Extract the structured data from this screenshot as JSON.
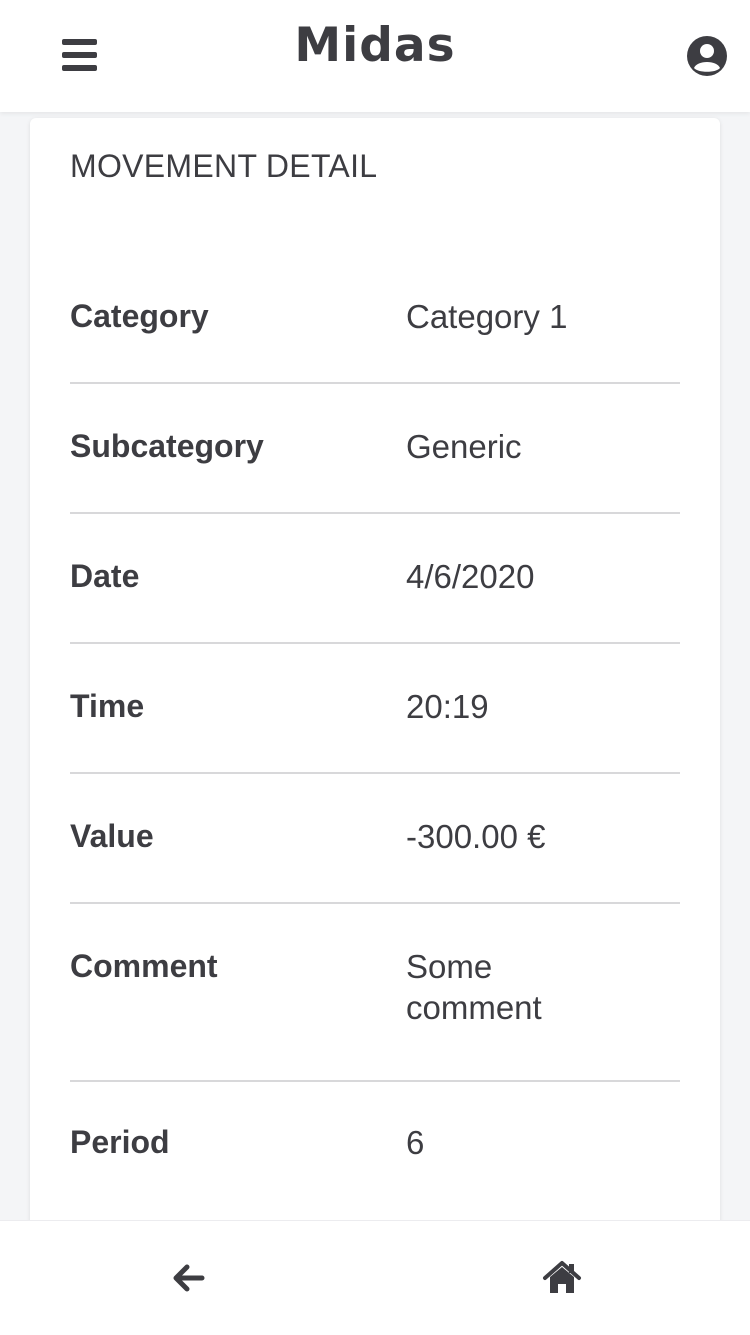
{
  "header": {
    "app_title": "Midas",
    "menu_icon": "hamburger-menu-icon",
    "user_icon": "user-circle-icon"
  },
  "card": {
    "title": "MOVEMENT DETAIL",
    "rows": [
      {
        "label": "Category",
        "value": "Category 1"
      },
      {
        "label": "Subcategory",
        "value": "Generic"
      },
      {
        "label": "Date",
        "value": "4/6/2020"
      },
      {
        "label": "Time",
        "value": "20:19"
      },
      {
        "label": "Value",
        "value": "-300.00 €"
      },
      {
        "label": "Comment",
        "value": "Some comment"
      },
      {
        "label": "Period",
        "value": "6"
      }
    ]
  },
  "footer": {
    "back_icon": "arrow-left-icon",
    "home_icon": "home-icon"
  },
  "colors": {
    "text": "#3d3d42",
    "background": "#f4f5f7",
    "surface": "#ffffff",
    "divider": "#d8d8da"
  }
}
